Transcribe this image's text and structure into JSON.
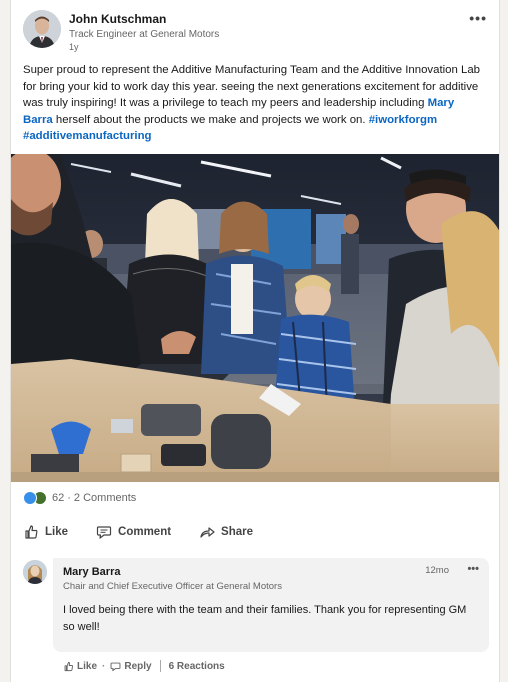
{
  "post": {
    "author_name": "John Kutschman",
    "author_headline": "Track Engineer at General Motors",
    "age": "1y",
    "more_label": "•••",
    "text_part1": "Super proud to represent the Additive Manufacturing Team and the Additive Innovation Lab for bring your kid to work day this year. seeing the next generations excitement for additive was truly inspiring! It was a privilege to teach my peers and leadership including ",
    "mention": "Mary Barra",
    "text_part2": " herself about the products we make and projects we work on. ",
    "hashtag1": "#iworkforgm",
    "hashtag2": "#additivemanufacturing"
  },
  "social": {
    "reactions_count": "62",
    "separator": "·",
    "comments_count": "2 Comments"
  },
  "actions": {
    "like": "Like",
    "comment": "Comment",
    "share": "Share"
  },
  "comment": {
    "name": "Mary Barra",
    "headline": "Chair and Chief Executive Officer at General Motors",
    "time": "12mo",
    "more_label": "•••",
    "text": "I loved being there with the team and their families. Thank you for representing GM so well!",
    "like_label": "Like",
    "reply_label": "Reply",
    "dot": "·",
    "reactions_label": "6 Reactions"
  },
  "colors": {
    "link_blue": "#0a66c2",
    "like_blue": "#378fe9",
    "celebrate_green": "#44712e"
  }
}
